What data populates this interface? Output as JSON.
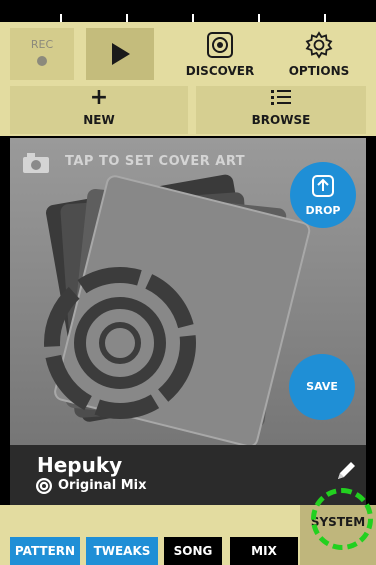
{
  "colors": {
    "accent": "#1f8fd6",
    "panel": "#e3dca0",
    "highlight": "#22d11f"
  },
  "toolbar": {
    "rec_label": "REC",
    "discover_label": "DISCOVER",
    "options_label": "OPTIONS",
    "new_label": "NEW",
    "browse_label": "BROWSE"
  },
  "cover": {
    "set_cover_text": "TAP TO SET COVER ART",
    "drop_label": "DROP",
    "save_label": "SAVE"
  },
  "track": {
    "title": "Hepuky",
    "mix_type": "Original Mix"
  },
  "tabs": [
    {
      "label": "PATTERN"
    },
    {
      "label": "TWEAKS"
    },
    {
      "label": "SONG"
    },
    {
      "label": "MIX"
    }
  ],
  "system_label": "SYSTEM"
}
